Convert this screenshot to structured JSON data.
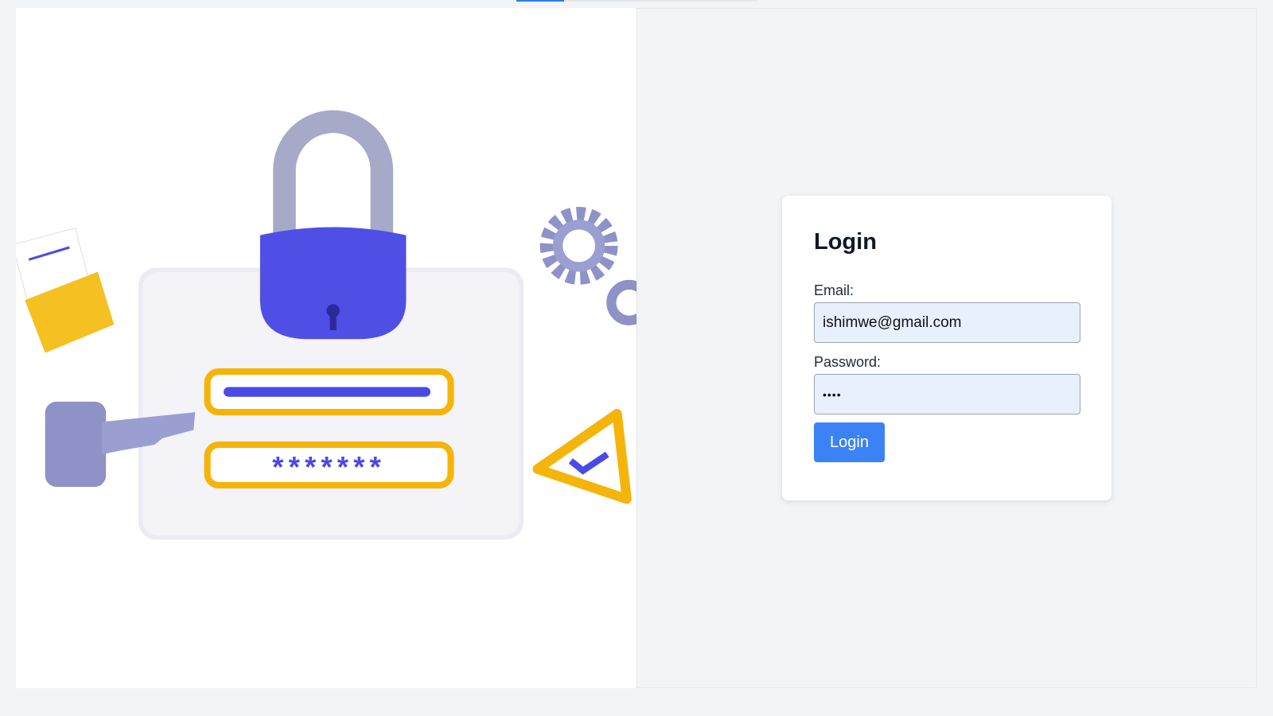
{
  "progress": {
    "value_percent": 20
  },
  "illustration": {
    "description_icon": "lock-login-illustration"
  },
  "login": {
    "title": "Login",
    "email_label": "Email:",
    "email_value": "ishimwe@gmail.com",
    "password_label": "Password:",
    "password_value": "abcd",
    "submit_label": "Login"
  },
  "colors": {
    "accent": "#3b82f6",
    "illustration_blue": "#4f4fe6",
    "illustration_yellow": "#f7b500"
  }
}
